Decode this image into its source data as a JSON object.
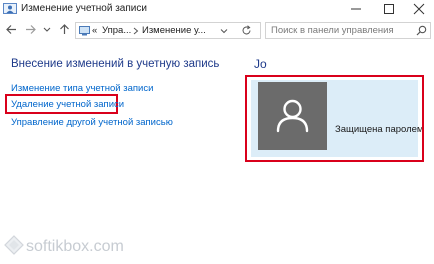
{
  "window": {
    "title": "Изменение учетной записи",
    "icon": "user-accounts-icon",
    "controls": [
      "minimize-icon",
      "maximize-icon",
      "close-icon"
    ]
  },
  "nav": {
    "buttons": [
      "back-arrow-icon",
      "forward-arrow-icon",
      "dropdown-icon",
      "up-arrow-icon"
    ],
    "breadcrumb": {
      "overflow": "«",
      "items": [
        "Упра...",
        "Изменение у..."
      ]
    },
    "search": {
      "placeholder": "Поиск в панели управления"
    }
  },
  "main": {
    "heading": "Внесение изменений в учетную запись",
    "links": [
      "Изменение типа учетной записи",
      "Удаление учетной записи",
      "Управление другой учетной записью"
    ],
    "highlighted_link": "Удаление учетной записи"
  },
  "account": {
    "name": "Jo",
    "status": "Защищена паролем",
    "avatar_icon": "user-silhouette-icon"
  },
  "watermark": {
    "text": "softikbox.com"
  },
  "colors": {
    "heading": "#1e3a8a",
    "link": "#0066cc",
    "highlight": "#d9001b",
    "card_bg": "#dcedf8",
    "avatar_bg": "#6b6b6b"
  }
}
